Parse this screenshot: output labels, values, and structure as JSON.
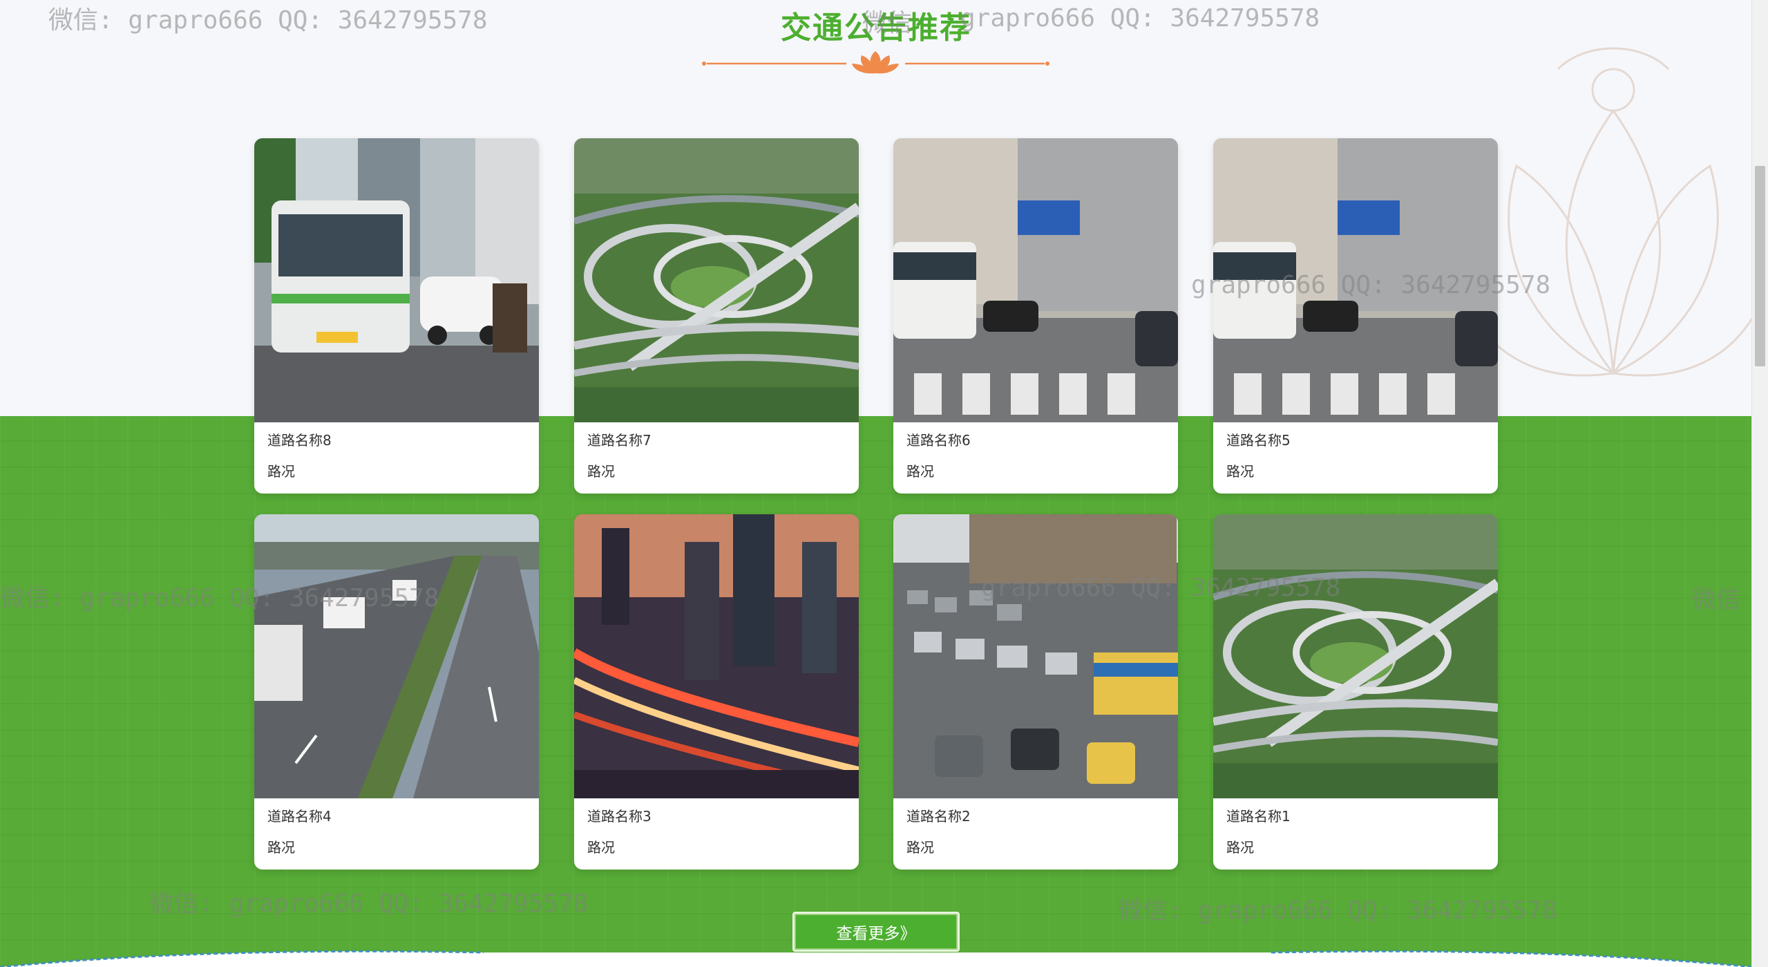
{
  "section": {
    "title": "交通公告推荐"
  },
  "cards": [
    {
      "name": "道路名称8",
      "status": "路况",
      "image": "bus-street-photo"
    },
    {
      "name": "道路名称7",
      "status": "路况",
      "image": "interchange-aerial-photo"
    },
    {
      "name": "道路名称6",
      "status": "路况",
      "image": "city-street-bus-photo"
    },
    {
      "name": "道路名称5",
      "status": "路况",
      "image": "city-street-bus-photo"
    },
    {
      "name": "道路名称4",
      "status": "路况",
      "image": "highway-trucks-photo"
    },
    {
      "name": "道路名称3",
      "status": "路况",
      "image": "night-overpass-photo"
    },
    {
      "name": "道路名称2",
      "status": "路况",
      "image": "traffic-jam-photo"
    },
    {
      "name": "道路名称1",
      "status": "路况",
      "image": "interchange-aerial-photo"
    }
  ],
  "more_button": {
    "label": "查看更多》"
  },
  "watermarks": [
    "微信: grapro666 QQ: 3642795578",
    "微信",
    "grapro666 QQ: 3642795578"
  ],
  "colors": {
    "accent_green": "#4caf2f",
    "band_green": "#57ab36",
    "divider_orange": "#f08a4b",
    "background": "#f6f7fa"
  }
}
